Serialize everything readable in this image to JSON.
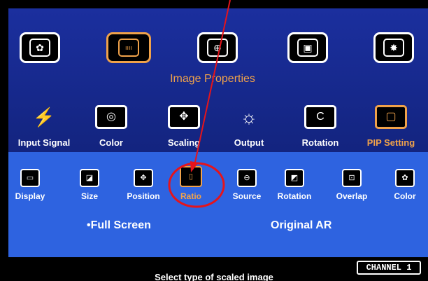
{
  "top_menu": {
    "title": "Image Properties",
    "icons": [
      {
        "name": "palette-icon",
        "glyph": "✿"
      },
      {
        "name": "image-properties-icon",
        "glyph": "ıııı"
      },
      {
        "name": "globe-icon",
        "glyph": "⊕"
      },
      {
        "name": "3d-cube-icon",
        "glyph": "▣"
      },
      {
        "name": "gear-icon",
        "glyph": "✸"
      }
    ]
  },
  "mid_menu": {
    "items": [
      {
        "label": "Input Signal",
        "icon": "plug-icon",
        "glyph": "⚡"
      },
      {
        "label": "Color",
        "icon": "color-icon",
        "glyph": "◎"
      },
      {
        "label": "Scaling",
        "icon": "scaling-icon",
        "glyph": "✥"
      },
      {
        "label": "Output",
        "icon": "sun-output-icon",
        "glyph": "☼"
      },
      {
        "label": "Rotation",
        "icon": "rotation-icon",
        "glyph": "C"
      },
      {
        "label": "PIP Setting",
        "icon": "pip-icon",
        "glyph": "▢"
      }
    ]
  },
  "sub_menu": {
    "items": [
      {
        "label": "Display",
        "icon": "display-icon",
        "glyph": "▭"
      },
      {
        "label": "Size",
        "icon": "size-icon",
        "glyph": "◪"
      },
      {
        "label": "Position",
        "icon": "position-icon",
        "glyph": "✥"
      },
      {
        "label": "Ratio",
        "icon": "ratio-icon",
        "glyph": "▯"
      },
      {
        "label": "Source",
        "icon": "source-icon",
        "glyph": "⊖"
      },
      {
        "label": "Rotation",
        "icon": "rotation-sub-icon",
        "glyph": "◩"
      },
      {
        "label": "Overlap",
        "icon": "overlap-icon",
        "glyph": "⊡"
      },
      {
        "label": "Color",
        "icon": "color-sub-icon",
        "glyph": "✿"
      }
    ]
  },
  "options": {
    "full_screen": "Full Screen",
    "original_ar": "Original AR"
  },
  "footer": {
    "channel": "CHANNEL 1",
    "hint": "Select type of scaled image"
  },
  "colors": {
    "accent": "#f0a24a",
    "top_panel": "#1b2f9e",
    "sub_panel": "#2e63e0",
    "annotation": "#e5141b"
  }
}
